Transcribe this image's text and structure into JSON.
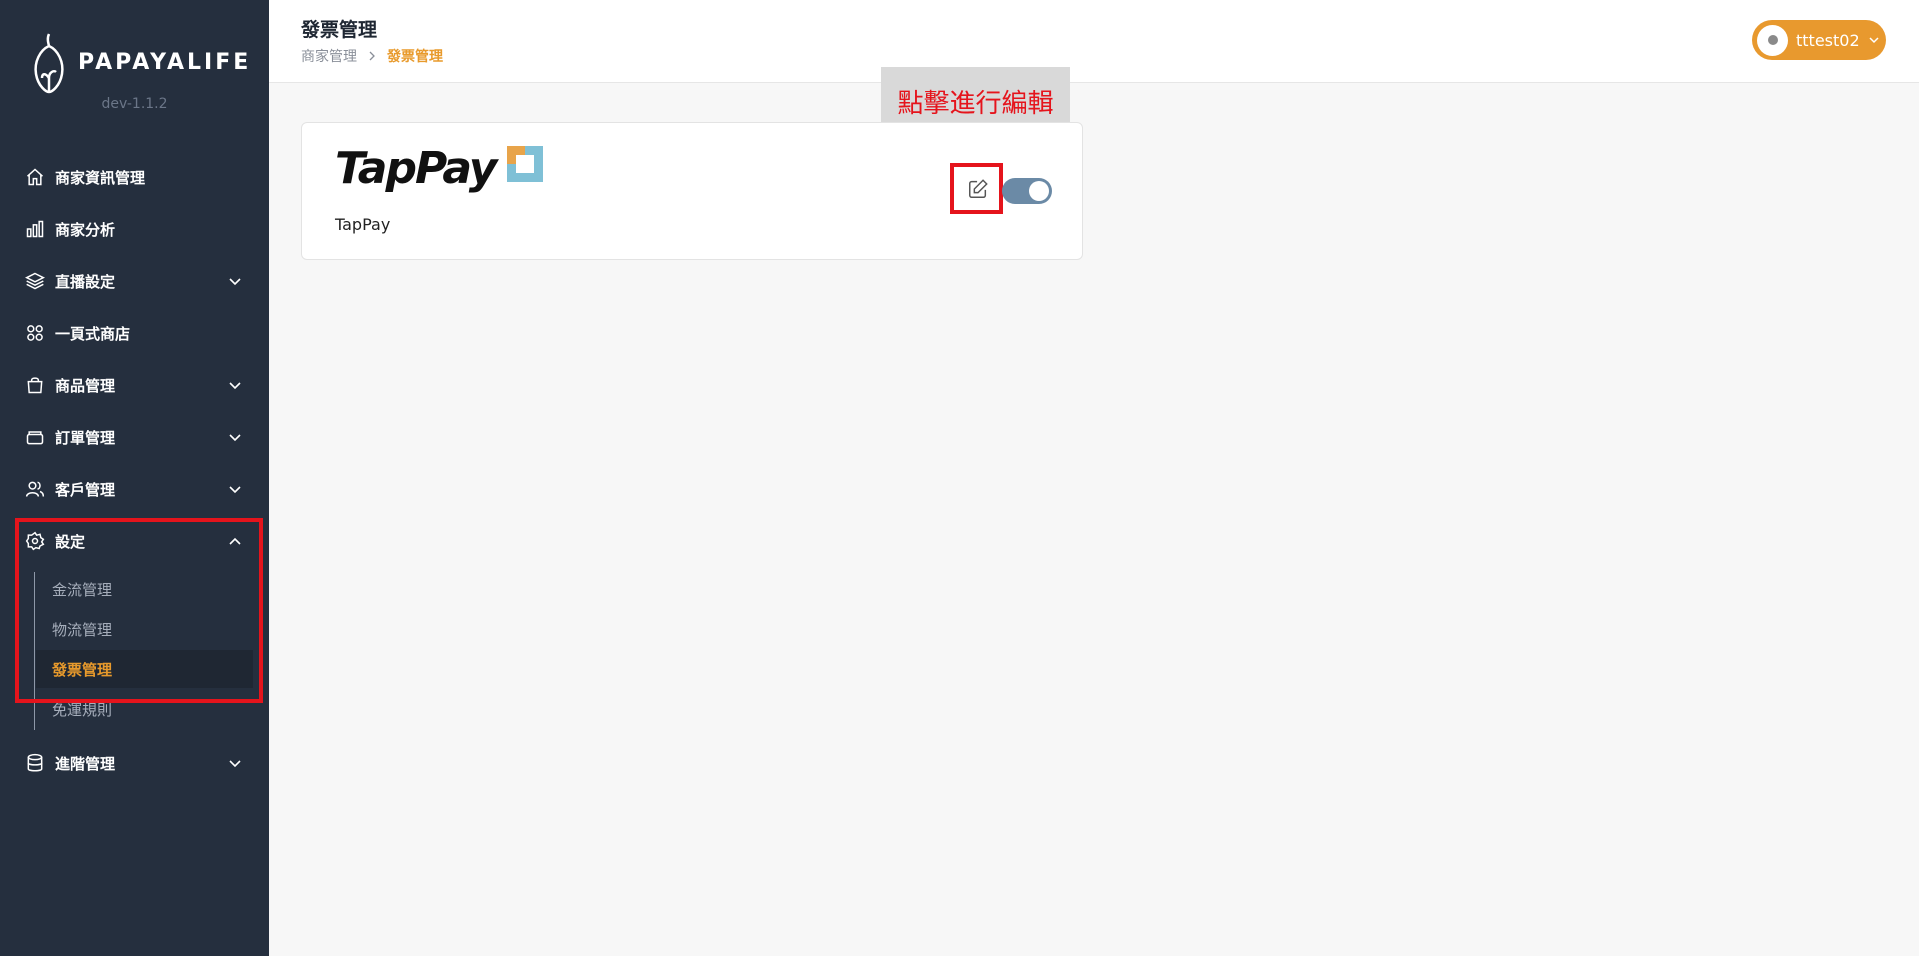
{
  "brand": {
    "name": "PAPAYALIFE",
    "version": "dev-1.1.2"
  },
  "sidebar": {
    "items": [
      {
        "label": "商家資訊管理",
        "icon": "home-icon"
      },
      {
        "label": "商家分析",
        "icon": "bar-chart-icon"
      },
      {
        "label": "直播設定",
        "icon": "layers-icon",
        "expandable": true
      },
      {
        "label": "一頁式商店",
        "icon": "grid-icon"
      },
      {
        "label": "商品管理",
        "icon": "shopping-bag-icon",
        "expandable": true
      },
      {
        "label": "訂單管理",
        "icon": "archive-icon",
        "expandable": true
      },
      {
        "label": "客戶管理",
        "icon": "users-icon",
        "expandable": true
      },
      {
        "label": "設定",
        "icon": "gear-icon",
        "expanded": true
      },
      {
        "label": "進階管理",
        "icon": "database-icon",
        "expandable": true
      }
    ],
    "settings_sub": [
      {
        "label": "金流管理"
      },
      {
        "label": "物流管理"
      },
      {
        "label": "發票管理",
        "active": true
      },
      {
        "label": "免運規則"
      }
    ]
  },
  "header": {
    "title": "發票管理",
    "breadcrumb": [
      "商家管理",
      "發票管理"
    ],
    "user": "tttest02"
  },
  "card": {
    "logo_text": "TapPay",
    "label": "TapPay",
    "enabled": true
  },
  "annotation": {
    "callout": "點擊進行編輯"
  },
  "colors": {
    "sidebar": "#252f3e",
    "accent": "#e89a2c",
    "highlight": "#e5141c",
    "toggle": "#6b8aa6"
  }
}
